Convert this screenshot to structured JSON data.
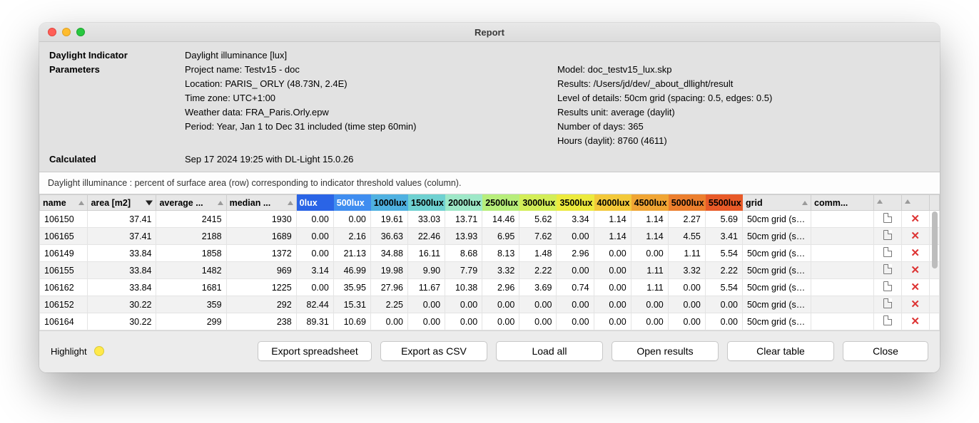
{
  "window": {
    "title": "Report"
  },
  "header": {
    "labels": {
      "indicator": "Daylight Indicator",
      "parameters": "Parameters",
      "calculated": "Calculated"
    },
    "indicator": "Daylight illuminance [lux]",
    "left": {
      "project": "Project name: Testv15 - doc",
      "location": "Location: PARIS_ ORLY (48.73N, 2.4E)",
      "timezone": "Time zone: UTC+1:00",
      "weather": "Weather data: FRA_Paris.Orly.epw",
      "period": "Period: Year, Jan 1 to Dec 31 included (time step 60min)"
    },
    "right": {
      "model": "Model: doc_testv15_lux.skp",
      "results": "Results: /Users/jd/dev/_about_dllight/result",
      "lod": "Level of details: 50cm grid (spacing: 0.5, edges: 0.5)",
      "unit": "Results unit: average (daylit)",
      "days": "Number of days: 365",
      "hours": "Hours (daylit): 8760 (4611)"
    },
    "calculated": "Sep 17 2024 19:25 with DL-Light 15.0.26",
    "caption": "Daylight illuminance : percent of surface area (row) corresponding to indicator threshold values (column)."
  },
  "columns": {
    "name": "name",
    "area": "area [m2]",
    "avg": "average ...",
    "med": "median ...",
    "lux": [
      "0lux",
      "500lux",
      "1000lux",
      "1500lux",
      "2000lux",
      "2500lux",
      "3000lux",
      "3500lux",
      "4000lux",
      "4500lux",
      "5000lux",
      "5500lux"
    ],
    "lux_colors": [
      "#2a64e6",
      "#3f8df0",
      "#4fb1e1",
      "#6fd1d1",
      "#9ee8c8",
      "#b7ee7b",
      "#d3ee58",
      "#ecea3e",
      "#f3c93a",
      "#f0a534",
      "#ec7f2e",
      "#e85a28"
    ],
    "grid": "grid",
    "comm": "comm..."
  },
  "rows": [
    {
      "name": "106150",
      "area": "37.41",
      "avg": "2415",
      "med": "1930",
      "vals": [
        "0.00",
        "0.00",
        "19.61",
        "33.03",
        "13.71",
        "14.46",
        "5.62",
        "3.34",
        "1.14",
        "1.14",
        "2.27",
        "5.69"
      ],
      "grid": "50cm grid (sp..."
    },
    {
      "name": "106165",
      "area": "37.41",
      "avg": "2188",
      "med": "1689",
      "vals": [
        "0.00",
        "2.16",
        "36.63",
        "22.46",
        "13.93",
        "6.95",
        "7.62",
        "0.00",
        "1.14",
        "1.14",
        "4.55",
        "3.41"
      ],
      "grid": "50cm grid (sp..."
    },
    {
      "name": "106149",
      "area": "33.84",
      "avg": "1858",
      "med": "1372",
      "vals": [
        "0.00",
        "21.13",
        "34.88",
        "16.11",
        "8.68",
        "8.13",
        "1.48",
        "2.96",
        "0.00",
        "0.00",
        "1.11",
        "5.54"
      ],
      "grid": "50cm grid (sp..."
    },
    {
      "name": "106155",
      "area": "33.84",
      "avg": "1482",
      "med": "969",
      "vals": [
        "3.14",
        "46.99",
        "19.98",
        "9.90",
        "7.79",
        "3.32",
        "2.22",
        "0.00",
        "0.00",
        "1.11",
        "3.32",
        "2.22"
      ],
      "grid": "50cm grid (sp..."
    },
    {
      "name": "106162",
      "area": "33.84",
      "avg": "1681",
      "med": "1225",
      "vals": [
        "0.00",
        "35.95",
        "27.96",
        "11.67",
        "10.38",
        "2.96",
        "3.69",
        "0.74",
        "0.00",
        "1.11",
        "0.00",
        "5.54"
      ],
      "grid": "50cm grid (sp..."
    },
    {
      "name": "106152",
      "area": "30.22",
      "avg": "359",
      "med": "292",
      "vals": [
        "82.44",
        "15.31",
        "2.25",
        "0.00",
        "0.00",
        "0.00",
        "0.00",
        "0.00",
        "0.00",
        "0.00",
        "0.00",
        "0.00"
      ],
      "grid": "50cm grid (sp..."
    },
    {
      "name": "106164",
      "area": "30.22",
      "avg": "299",
      "med": "238",
      "vals": [
        "89.31",
        "10.69",
        "0.00",
        "0.00",
        "0.00",
        "0.00",
        "0.00",
        "0.00",
        "0.00",
        "0.00",
        "0.00",
        "0.00"
      ],
      "grid": "50cm grid (sp..."
    }
  ],
  "footer": {
    "highlight": "Highlight",
    "buttons": {
      "export_xls": "Export spreadsheet",
      "export_csv": "Export as CSV",
      "load": "Load all",
      "open": "Open results",
      "clear": "Clear table",
      "close": "Close"
    }
  }
}
